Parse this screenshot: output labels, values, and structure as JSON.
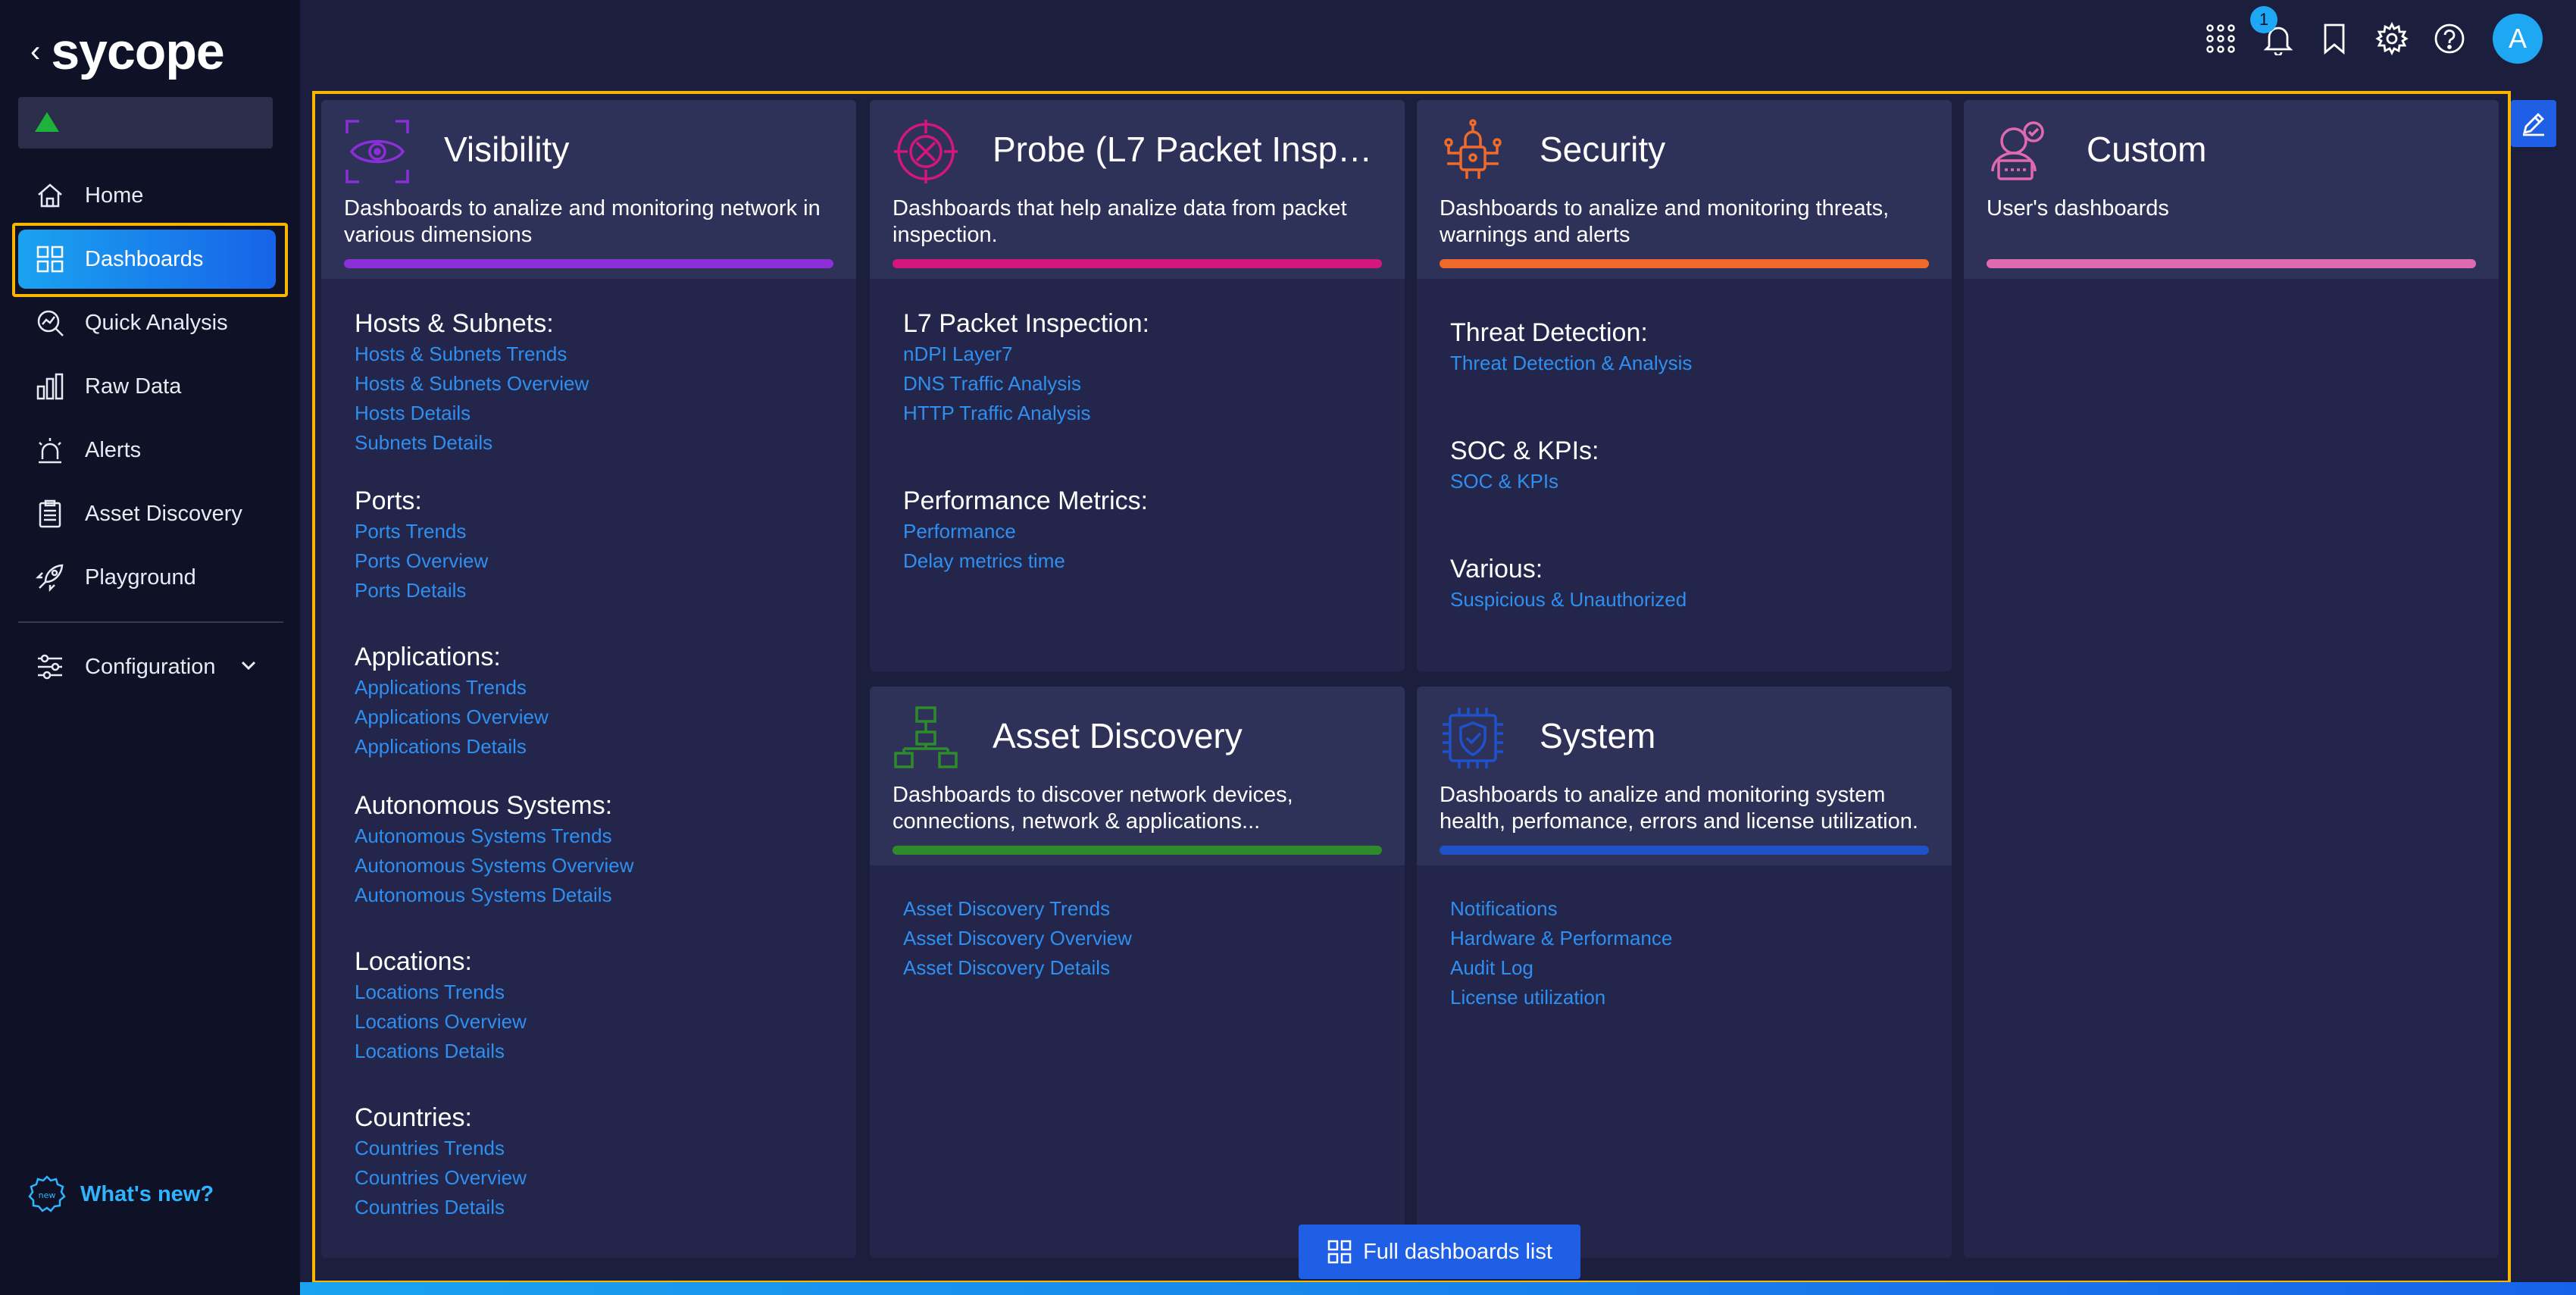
{
  "app": {
    "logo": "sycope",
    "back_icon": "chevron-left-icon"
  },
  "colors": {
    "accent": "#1763e8",
    "highlight": "#f7b500",
    "link": "#2f8ff0",
    "visibility": "#8b2fd8",
    "probe": "#d4177a",
    "security": "#f06a2c",
    "custom": "#e06ab0",
    "asset": "#2f8a2c",
    "system": "#1f52c8"
  },
  "sidebar": {
    "items": [
      {
        "label": "Home",
        "icon": "home-icon"
      },
      {
        "label": "Dashboards",
        "icon": "dashboard-grid-icon",
        "active": true
      },
      {
        "label": "Quick Analysis",
        "icon": "quick-analysis-icon"
      },
      {
        "label": "Raw Data",
        "icon": "bar-chart-icon"
      },
      {
        "label": "Alerts",
        "icon": "alarm-icon"
      },
      {
        "label": "Asset Discovery",
        "icon": "clipboard-icon"
      },
      {
        "label": "Playground",
        "icon": "rocket-icon"
      }
    ],
    "configuration": {
      "label": "Configuration",
      "icon": "sliders-icon"
    },
    "whats_new": "What's new?"
  },
  "topbar": {
    "notification_count": "1",
    "avatar_initial": "A",
    "icons": [
      "apps-grid-icon",
      "bell-icon",
      "bookmark-icon",
      "gear-icon",
      "help-icon"
    ]
  },
  "cards": {
    "visibility": {
      "title": "Visibility",
      "desc": "Dashboards to analize and monitoring network in various dimensions",
      "sections": [
        {
          "title": "Hosts & Subnets:",
          "links": [
            "Hosts & Subnets Trends",
            "Hosts & Subnets Overview",
            "Hosts Details",
            "Subnets Details"
          ]
        },
        {
          "title": "Ports:",
          "links": [
            "Ports Trends",
            "Ports Overview",
            "Ports Details"
          ]
        },
        {
          "title": "Applications:",
          "links": [
            "Applications Trends",
            "Applications Overview",
            "Applications Details"
          ]
        },
        {
          "title": "Autonomous Systems:",
          "links": [
            "Autonomous Systems Trends",
            "Autonomous Systems Overview",
            "Autonomous Systems Details"
          ]
        },
        {
          "title": "Locations:",
          "links": [
            "Locations Trends",
            "Locations Overview",
            "Locations Details"
          ]
        },
        {
          "title": "Countries:",
          "links": [
            "Countries Trends",
            "Countries Overview",
            "Countries Details"
          ]
        }
      ]
    },
    "probe": {
      "title": "Probe (L7 Packet Inspecti...",
      "desc": "Dashboards that help analize data from packet inspection.",
      "sections": [
        {
          "title": "L7 Packet Inspection:",
          "links": [
            "nDPI Layer7",
            "DNS Traffic Analysis",
            "HTTP Traffic Analysis"
          ]
        },
        {
          "title": "Performance Metrics:",
          "links": [
            "Performance",
            "Delay metrics time"
          ]
        }
      ]
    },
    "security": {
      "title": "Security",
      "desc": "Dashboards to analize and monitoring threats, warnings and alerts",
      "sections": [
        {
          "title": "Threat Detection:",
          "links": [
            "Threat Detection & Analysis"
          ]
        },
        {
          "title": "SOC & KPIs:",
          "links": [
            "SOC & KPIs"
          ]
        },
        {
          "title": "Various:",
          "links": [
            "Suspicious & Unauthorized"
          ]
        }
      ]
    },
    "custom": {
      "title": "Custom",
      "desc": "User's dashboards"
    },
    "asset": {
      "title": "Asset Discovery",
      "desc": "Dashboards to discover network devices, connections, network & applications...",
      "links": [
        "Asset Discovery Trends",
        "Asset Discovery Overview",
        "Asset Discovery Details"
      ]
    },
    "system": {
      "title": "System",
      "desc": "Dashboards to analize and monitoring system health, perfomance, errors and license utilization.",
      "links": [
        "Notifications",
        "Hardware & Performance",
        "Audit Log",
        "License utilization"
      ]
    }
  },
  "full_list_button": "Full dashboards list"
}
